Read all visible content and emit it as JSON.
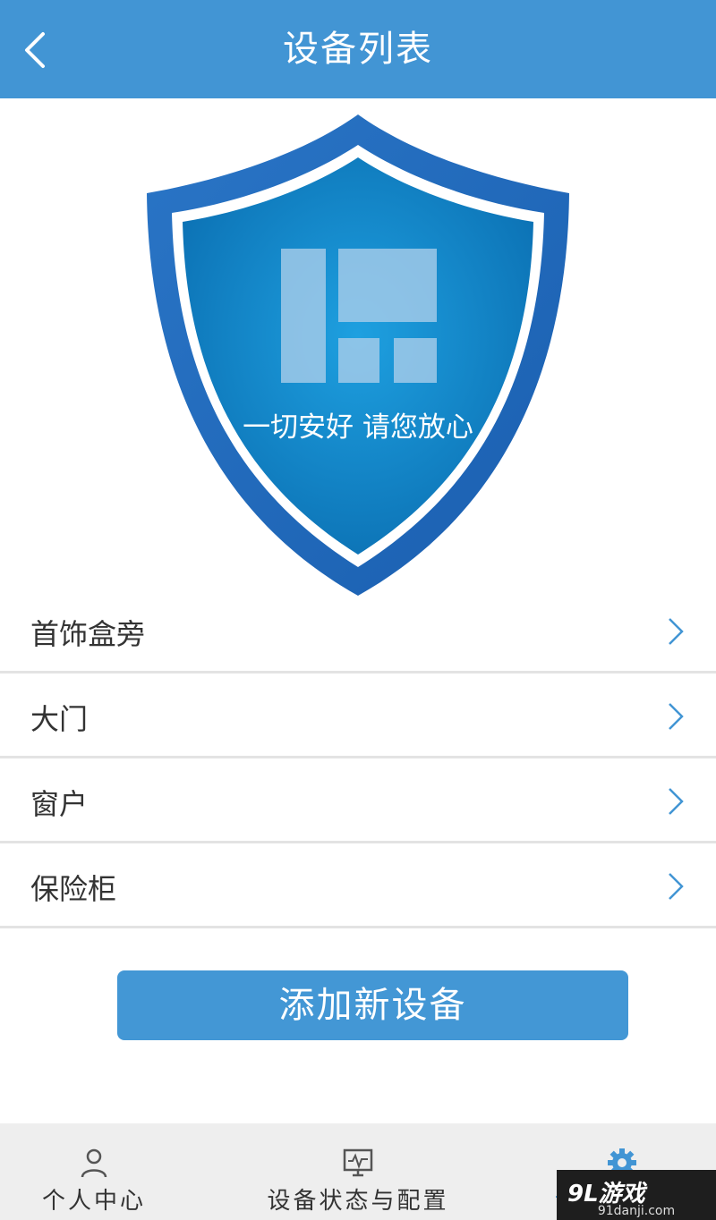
{
  "header": {
    "title": "设备列表",
    "back_icon": "chevron-left-icon"
  },
  "shield": {
    "tagline": "一切安好 请您放心",
    "icon": "shield-logo-icon"
  },
  "devices": [
    {
      "label": "首饰盒旁"
    },
    {
      "label": "大门"
    },
    {
      "label": "窗户"
    },
    {
      "label": "保险柜"
    }
  ],
  "add_button": {
    "label": "添加新设备"
  },
  "tabbar": {
    "tabs": [
      {
        "label": "个人中心",
        "icon": "person-icon"
      },
      {
        "label": "设备状态与配置",
        "icon": "monitor-icon"
      },
      {
        "label": "设",
        "icon": "gear-icon",
        "active": true
      }
    ]
  },
  "watermark": {
    "logo": "9L游戏",
    "site": "91danji.com"
  },
  "colors": {
    "accent": "#4295d4",
    "text": "#333333",
    "divider": "#e3e3e3",
    "tabbar_bg": "#eeeeee"
  }
}
